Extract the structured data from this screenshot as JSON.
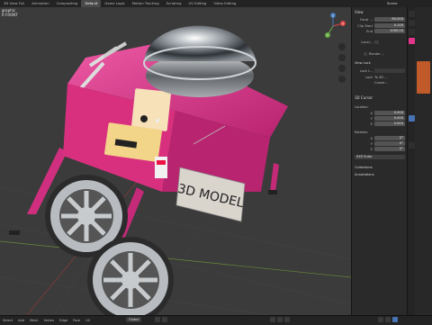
{
  "topbar": {
    "tabs": [
      "3D View Full",
      "Animation",
      "Compositing",
      "Default",
      "Game Logic",
      "Motion Tracking",
      "Scripting",
      "UV Editing",
      "Video Editing"
    ],
    "active_tab": "Default",
    "scene": "Scene"
  },
  "viewport": {
    "header_line1": "graphic",
    "header_line2": "R FRONT",
    "sign_text": "3D MODEL"
  },
  "npanel": {
    "view_title": "View",
    "lens_label": "Focal ...",
    "lens_value": "60.000",
    "clip_start_label": "Clip Start",
    "clip_start_value": "0.100",
    "clip_end_label": "End",
    "clip_end_value": "1000.00",
    "local_camera_label": "Local...",
    "render_region_label": "Render ...",
    "view_lock_title": "View Lock",
    "lock_to_label": "Lock t...",
    "lock_label": "Lock",
    "lock_to_3d": "To 3D ...",
    "lock_camera": "Camer...",
    "cursor_title": "3D Cursor",
    "location_label": "Location:",
    "loc_x": "0.000",
    "loc_y": "0.000",
    "loc_z": "0.000",
    "rotation_label": "Rotation:",
    "rot_x": "0°",
    "rot_y": "0°",
    "rot_z": "0°",
    "rot_mode": "XYZ Euler",
    "collections_title": "Collections",
    "annotations_title": "Annotations",
    "axis_x": "X",
    "axis_y": "Y",
    "axis_z": "Z"
  },
  "bottombar": {
    "menus": [
      "Select",
      "Add",
      "Mesh",
      "Vertex",
      "Edge",
      "Face",
      "UV"
    ],
    "mode": "Global"
  },
  "colors": {
    "cart_pink": "#e0358a",
    "viewport_bg": "#3b3b3b",
    "panel_bg": "#2a2a2a",
    "accent_blue": "#4772b3"
  }
}
